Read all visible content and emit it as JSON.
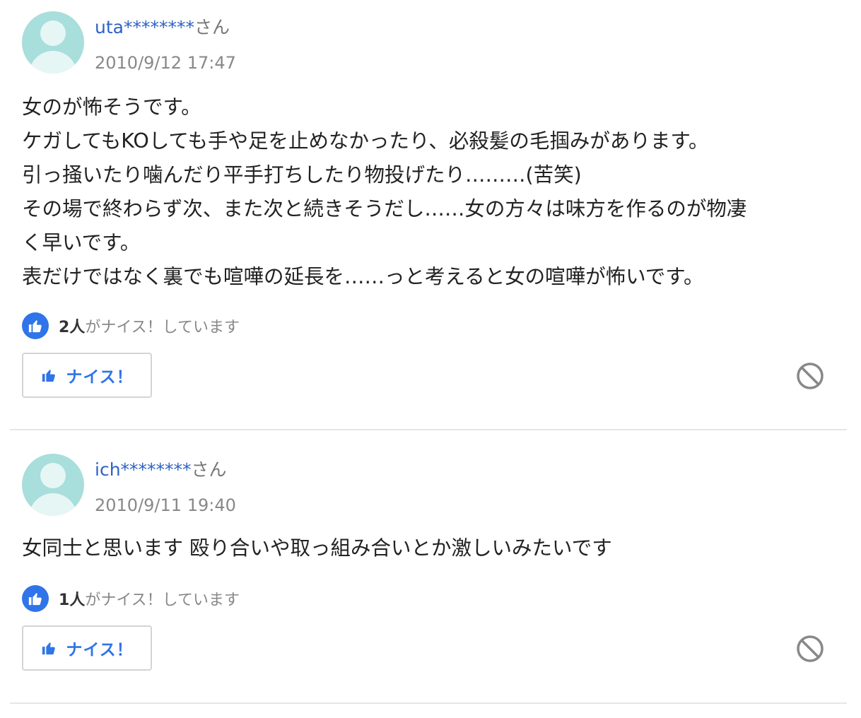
{
  "answers": [
    {
      "user_name": "uta********",
      "user_suffix": "さん",
      "date": "2010/9/12 17:47",
      "lines": [
        "女のが怖そうです。",
        "ケガしてもKOしても手や足を止めなかったり、必殺髪の毛掴みがあります。",
        "引っ掻いたり噛んだり平手打ちしたり物投げたり………(苦笑)",
        "その場で終わらず次、また次と続きそうだし……女の方々は味方を作るのが物凄",
        "く早いです。",
        "表だけではなく裏でも喧嘩の延長を……っと考えると女の喧嘩が怖いです。"
      ],
      "nice_count": "2人",
      "nice_suffix": "がナイス！しています",
      "nice_button_label": "ナイス！",
      "avatar_icon": "user-avatar-icon",
      "block_icon": "block-icon"
    },
    {
      "user_name": "ich********",
      "user_suffix": "さん",
      "date": "2010/9/11 19:40",
      "lines": [
        "女同士と思います 殴り合いや取っ組み合いとか激しいみたいです"
      ],
      "nice_count": "1人",
      "nice_suffix": "がナイス！しています",
      "nice_button_label": "ナイス！",
      "avatar_icon": "user-avatar-icon",
      "block_icon": "block-icon"
    }
  ],
  "colors": {
    "accent": "#2f74e8",
    "username": "#2e62c6",
    "meta": "#888888",
    "avatar_bg": "#a8dedb",
    "block_icon": "#888888"
  }
}
